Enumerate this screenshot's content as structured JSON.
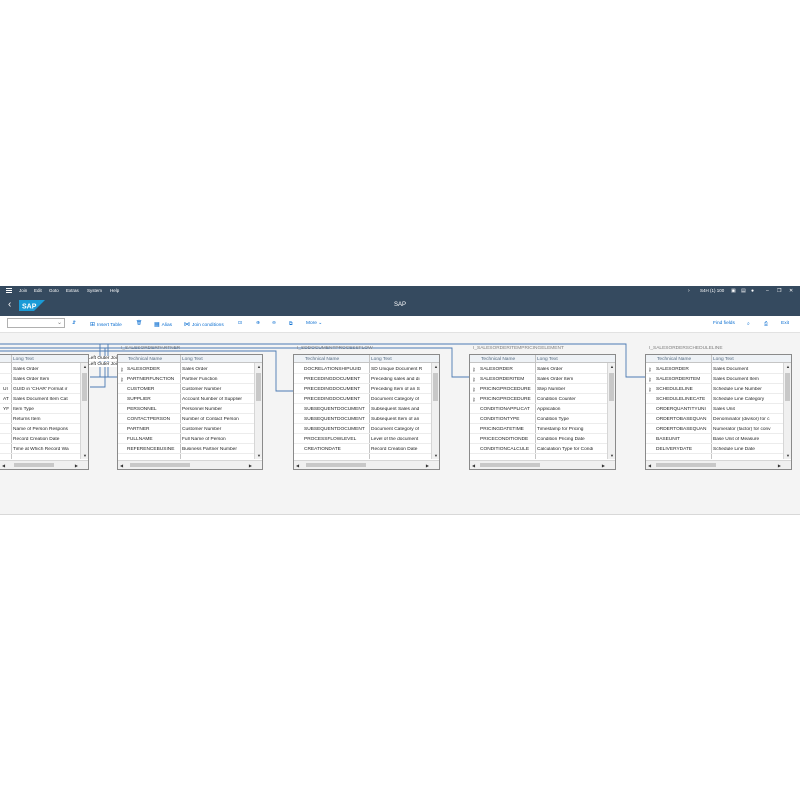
{
  "menubar": {
    "items": [
      "Join",
      "Edit",
      "Goto",
      "Extras",
      "System",
      "Help"
    ],
    "session": "S4H (1) 100"
  },
  "titlebar": {
    "title": "SAP",
    "logo_text": "SAP"
  },
  "toolbar": {
    "combo_value": "",
    "insert_table": "Insert Table",
    "alias": "Alias",
    "join_conditions": "Join conditions",
    "more": "More",
    "find_fields": "Find fields",
    "exit": "Exit"
  },
  "joins": {
    "label1": "Left Outer Join",
    "label2": "Left Outer Join"
  },
  "tables": [
    {
      "name": "",
      "col1": "",
      "col2": "Long Text",
      "rows": [
        {
          "prefix": "",
          "tech": "",
          "text": "Sales Order"
        },
        {
          "prefix": "",
          "tech": "",
          "text": "Sales Order Item"
        },
        {
          "prefix": "UI",
          "tech": "",
          "text": "GUID in 'CHAR' Format ir"
        },
        {
          "prefix": "AT",
          "tech": "",
          "text": "Sales Document Item Cat"
        },
        {
          "prefix": "YF",
          "tech": "",
          "text": "Item Type"
        },
        {
          "prefix": "",
          "tech": "",
          "text": "Returns Item"
        },
        {
          "prefix": "",
          "tech": "",
          "text": "Name of Person Respons"
        },
        {
          "prefix": "",
          "tech": "",
          "text": "Record Creation Date"
        },
        {
          "prefix": "",
          "tech": "",
          "text": "Time at Which Record Wa"
        }
      ]
    },
    {
      "name": "I_SALESORDERPARTNER",
      "col1": "Technical Name",
      "col2": "Long Text",
      "rows": [
        {
          "tech": "SALESORDER",
          "text": "Sales Order"
        },
        {
          "tech": "PARTNERFUNCTION",
          "text": "Partner Function"
        },
        {
          "tech": "CUSTOMER",
          "text": "Customer Number"
        },
        {
          "tech": "SUPPLIER",
          "text": "Account Number of Supplier"
        },
        {
          "tech": "PERSONNEL",
          "text": "Personnel Number"
        },
        {
          "tech": "CONTACTPERSON",
          "text": "Number of Contact Person"
        },
        {
          "tech": "PARTNER",
          "text": "Customer Number"
        },
        {
          "tech": "FULLNAME",
          "text": "Full Name of Person"
        },
        {
          "tech": "REFERENCEBUSINE",
          "text": "Business Partner Number"
        }
      ]
    },
    {
      "name": "I_SDDOCUMENTPROCESSFLOW",
      "col1": "Technical Name",
      "col2": "Long Text",
      "rows": [
        {
          "tech": "DOCRELATIONSHIPUUID",
          "text": "SD Unique Document R"
        },
        {
          "tech": "PRECEDINGDOCUMENT",
          "text": "Preceding sales and di"
        },
        {
          "tech": "PRECEDINGDOCUMENT",
          "text": "Preceding Item of an S"
        },
        {
          "tech": "PRECEDINGDOCUMENT",
          "text": "Document Category of"
        },
        {
          "tech": "SUBSEQUENTDOCUMENT",
          "text": "Subsequent Sales and"
        },
        {
          "tech": "SUBSEQUENTDOCUMENT",
          "text": "Subsequent Item of an"
        },
        {
          "tech": "SUBSEQUENTDOCUMENT",
          "text": "Document Category of"
        },
        {
          "tech": "PROCESSFLOWLEVEL",
          "text": "Level of the document"
        },
        {
          "tech": "CREATIONDATE",
          "text": "Record Creation Date"
        }
      ]
    },
    {
      "name": "I_SALESORDERITEMPRICINGELEMENT",
      "col1": "Technical Name",
      "col2": "Long Text",
      "rows": [
        {
          "tech": "SALESORDER",
          "text": "Sales Order"
        },
        {
          "tech": "SALESORDERITEM",
          "text": "Sales Order Item"
        },
        {
          "tech": "PRICINGPROCEDURE",
          "text": "Step Number"
        },
        {
          "tech": "PRICINGPROCEDURE",
          "text": "Condition Counter"
        },
        {
          "tech": "CONDITIONAPPLICAT",
          "text": "Application"
        },
        {
          "tech": "CONDITIONTYPE",
          "text": "Condition Type"
        },
        {
          "tech": "PRICINGDATETIME",
          "text": "Timestamp for Pricing"
        },
        {
          "tech": "PRICECONDITIONDE",
          "text": "Condition Pricing Date"
        },
        {
          "tech": "CONDITIONCALCULE",
          "text": "Calculation Type for Condi"
        }
      ]
    },
    {
      "name": "I_SALESORDERSCHEDULELINE",
      "col1": "Technical Name",
      "col2": "Long Text",
      "rows": [
        {
          "tech": "SALESORDER",
          "text": "Sales Document"
        },
        {
          "tech": "SALESORDERITEM",
          "text": "Sales Document Item"
        },
        {
          "tech": "SCHEDULELINE",
          "text": "Schedule Line Number"
        },
        {
          "tech": "SCHEDULELINECATE",
          "text": "Schedule Line Category"
        },
        {
          "tech": "ORDERQUANTITYUNI",
          "text": "Sales Unit"
        },
        {
          "tech": "ORDERTOBASEQUAN",
          "text": "Denominator (divisor) for c"
        },
        {
          "tech": "ORDERTOBASEQUAN",
          "text": "Numerator (factor) for conv"
        },
        {
          "tech": "BASEUNIT",
          "text": "Base Unit of Measure"
        },
        {
          "tech": "DELIVERYDATE",
          "text": "Schedule Line Date"
        }
      ]
    }
  ]
}
